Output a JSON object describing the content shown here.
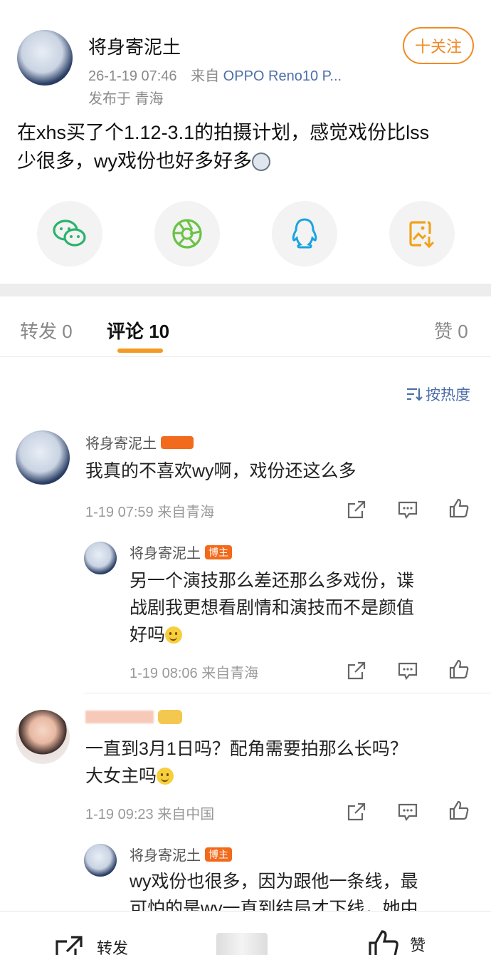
{
  "post": {
    "author": "将身寄泥土",
    "time": "26-1-19 07:46",
    "source_prefix": "来自",
    "source_device": "OPPO Reno10 P...",
    "location": "发布于 青海",
    "follow_label": "十关注",
    "text_line1": "在xhs买了个1.12-3.1的拍摄计划，感觉戏份比lss",
    "text_line2": "少很多，wy戏份也好多好多"
  },
  "share_icons": [
    "wechat-icon",
    "moments-icon",
    "qq-icon",
    "save-image-icon"
  ],
  "tabs": {
    "repost": "转发 0",
    "comment": "评论 10",
    "like": "赞 0"
  },
  "sort_label": "按热度",
  "comments": [
    {
      "user": "将身寄泥土",
      "text": "我真的不喜欢wy啊，戏份还这么多",
      "meta": "1-19 07:59 来自青海"
    },
    {
      "user": "将身寄泥土",
      "badge": "博主",
      "text_line1": "另一个演技那么差还那么多戏份，谍",
      "text_line2": "战剧我更想看剧情和演技而不是颜值",
      "text_line3": "好吗",
      "meta": "1-19 08:06 来自青海"
    },
    {
      "user": "",
      "text_line1": "一直到3月1日吗？配角需要拍那么长吗？",
      "text_line2": "大女主吗",
      "meta": "1-19 09:23 来自中国"
    },
    {
      "user": "将身寄泥土",
      "badge": "博主",
      "text_line1": "wy戏份也很多，因为跟他一条线，最",
      "text_line2": "可怕的是wy一直到结局才下线，她中"
    }
  ],
  "bottom_bar": {
    "repost": "转发",
    "like": "赞"
  },
  "colors": {
    "accent_orange": "#f08a24",
    "link_blue": "#4d6fa8",
    "badge_orange": "#f26a1b",
    "wechat_green": "#2ab36b",
    "qq_blue": "#1aa3e0",
    "save_yellow": "#f0a21b"
  }
}
